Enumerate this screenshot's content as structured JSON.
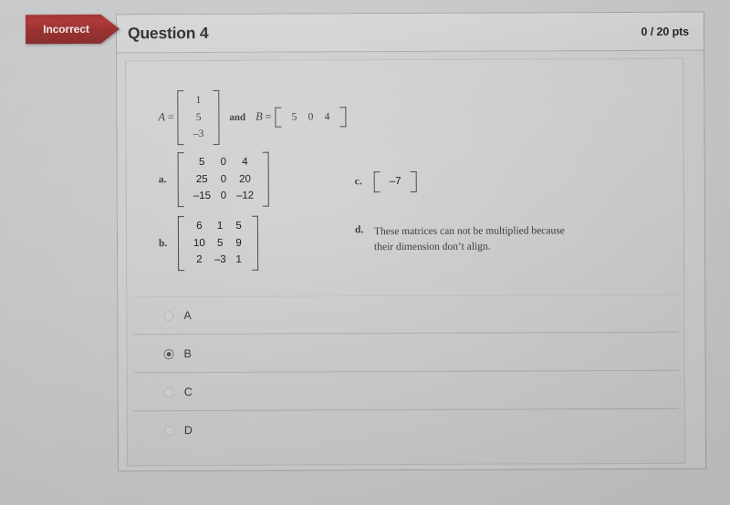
{
  "status_banner": {
    "label": "Incorrect",
    "color": "#9c1717"
  },
  "header": {
    "title": "Question 4",
    "points": "0 / 20 pts"
  },
  "given": {
    "matrix_a": {
      "name": "A",
      "equals": "=",
      "rows": 3,
      "cols": 1,
      "values": [
        "1",
        "5",
        "–3"
      ]
    },
    "conjunction": "and",
    "matrix_b": {
      "name": "B",
      "equals": "=",
      "rows": 1,
      "cols": 3,
      "values": [
        "5",
        "0",
        "4"
      ]
    }
  },
  "options": [
    {
      "letter": "a.",
      "kind": "matrix",
      "rows": 3,
      "cols": 3,
      "values": [
        "5",
        "0",
        "4",
        "25",
        "0",
        "20",
        "–15",
        "0",
        "–12"
      ]
    },
    {
      "letter": "b.",
      "kind": "matrix",
      "rows": 3,
      "cols": 3,
      "values": [
        "6",
        "1",
        "5",
        "10",
        "5",
        "9",
        "2",
        "–3",
        "1"
      ]
    },
    {
      "letter": "c.",
      "kind": "matrix",
      "rows": 1,
      "cols": 1,
      "values": [
        "–7"
      ]
    },
    {
      "letter": "d.",
      "kind": "text",
      "text": "These matrices can not be multiplied because their dimension don’t align."
    }
  ],
  "choices": [
    {
      "label": "A",
      "selected": false
    },
    {
      "label": "B",
      "selected": true
    },
    {
      "label": "C",
      "selected": false
    },
    {
      "label": "D",
      "selected": false
    }
  ]
}
